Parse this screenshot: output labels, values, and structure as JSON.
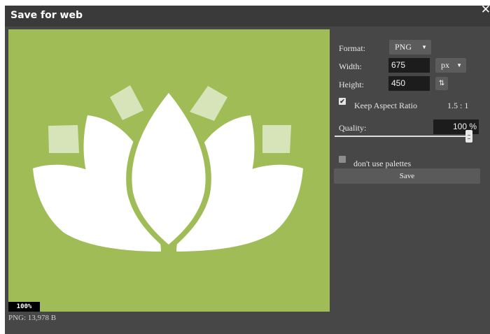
{
  "dialog": {
    "title": "Save for web",
    "close_glyph": "✕",
    "close_icon": "close-icon"
  },
  "preview": {
    "zoom": "100%",
    "file_info": "PNG: 13,978 B",
    "background_color": "#a0bc57",
    "image_icon": "lotus-icon"
  },
  "settings": {
    "format_label": "Format:",
    "format_value": "PNG",
    "width_label": "Width:",
    "width_value": "675",
    "unit_value": "px",
    "height_label": "Height:",
    "height_value": "450",
    "swap_glyph": "⇅",
    "keep_aspect_label": "Keep Aspect Ratio",
    "keep_aspect_checked": true,
    "check_glyph": "✔",
    "aspect_ratio": "1.5 : 1",
    "quality_label": "Quality:",
    "quality_value": "100 %",
    "quality_level": 1.0,
    "palette_label": "don't use palettes",
    "palette_checked": false,
    "save_label": "Save"
  },
  "colors": {
    "dialog_bg": "#474747",
    "titlebar_bg": "#3a3a3a",
    "input_bg": "#1c1c1c",
    "accent_green": "#a0bc57"
  }
}
